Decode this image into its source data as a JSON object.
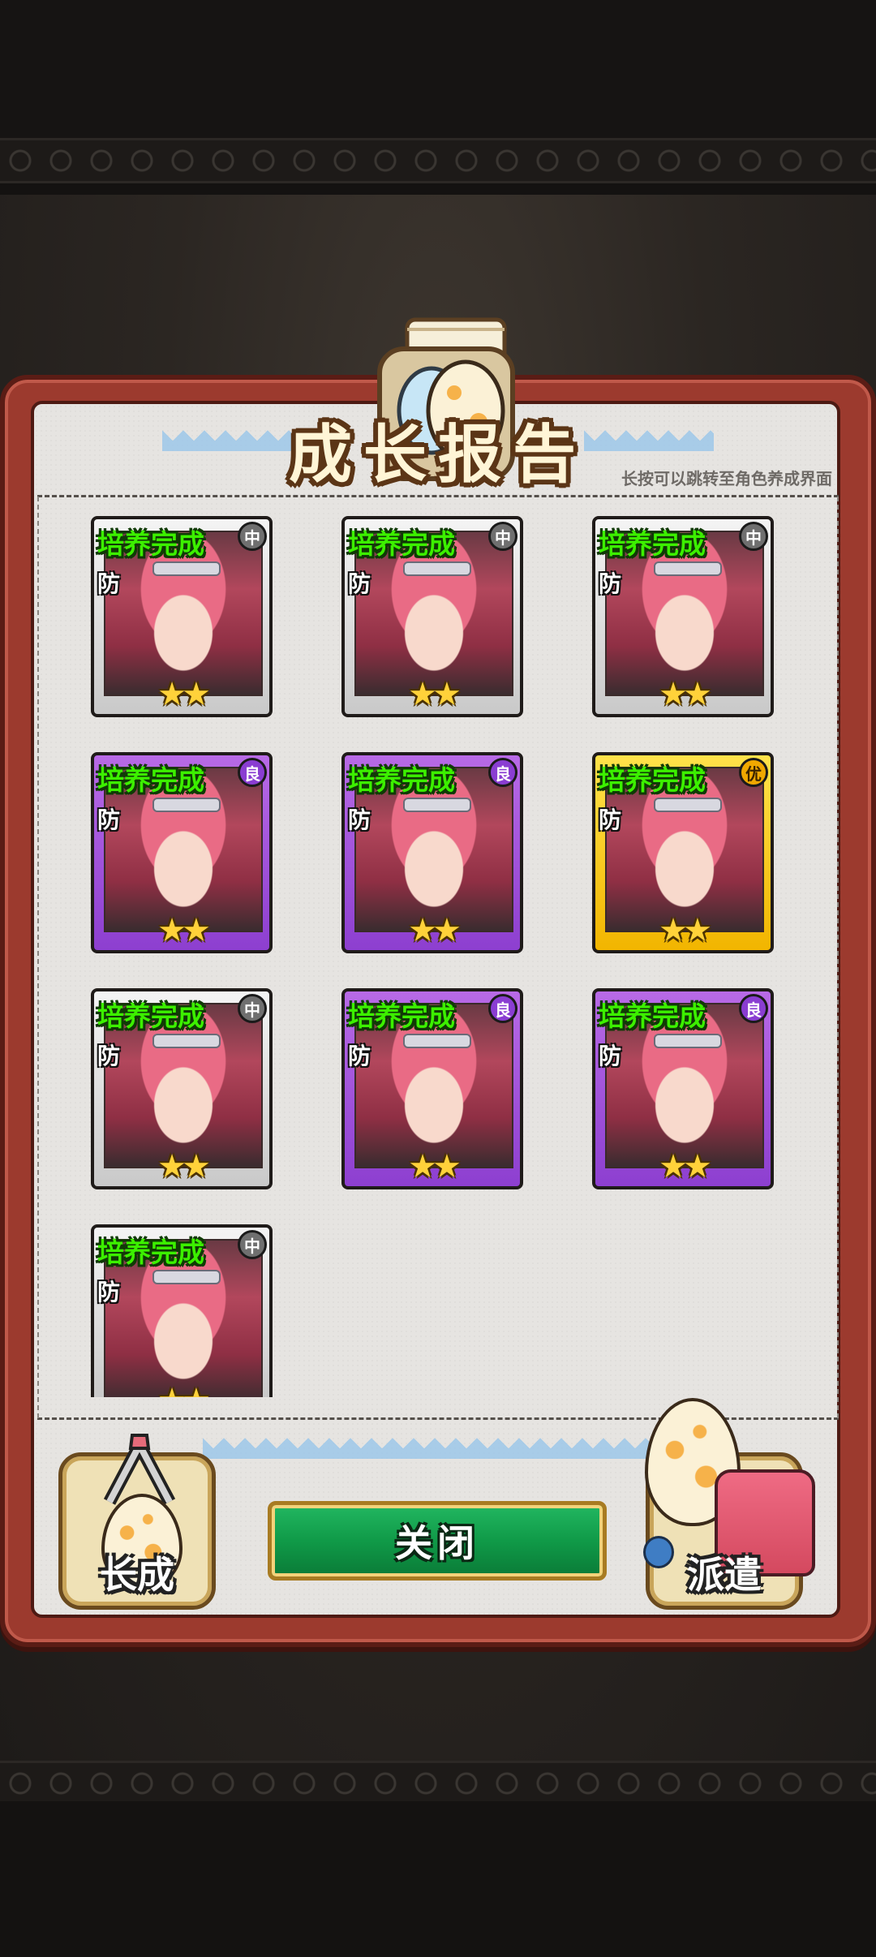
{
  "header": {
    "title": "成长报告",
    "hint": "长按可以跳转至角色养成界面"
  },
  "colors": {
    "rarity_mid": "#d9d9d9",
    "rarity_good": "#9b4fdc",
    "rarity_best": "#f7c400",
    "status_text": "#3cf000",
    "panel_frame": "#9c3a2e"
  },
  "results": [
    {
      "status": "培养完成",
      "role": "防",
      "grade": "中",
      "rarity": "mid",
      "stars": "★★"
    },
    {
      "status": "培养完成",
      "role": "防",
      "grade": "中",
      "rarity": "mid",
      "stars": "★★"
    },
    {
      "status": "培养完成",
      "role": "防",
      "grade": "中",
      "rarity": "mid",
      "stars": "★★"
    },
    {
      "status": "培养完成",
      "role": "防",
      "grade": "良",
      "rarity": "good",
      "stars": "★★"
    },
    {
      "status": "培养完成",
      "role": "防",
      "grade": "良",
      "rarity": "good",
      "stars": "★★"
    },
    {
      "status": "培养完成",
      "role": "防",
      "grade": "优",
      "rarity": "best",
      "stars": "★★"
    },
    {
      "status": "培养完成",
      "role": "防",
      "grade": "中",
      "rarity": "mid",
      "stars": "★★"
    },
    {
      "status": "培养完成",
      "role": "防",
      "grade": "良",
      "rarity": "good",
      "stars": "★★"
    },
    {
      "status": "培养完成",
      "role": "防",
      "grade": "良",
      "rarity": "good",
      "stars": "★★"
    },
    {
      "status": "培养完成",
      "role": "防",
      "grade": "中",
      "rarity": "mid",
      "stars": "★★"
    }
  ],
  "buttons": {
    "grow": "长成",
    "close": "关闭",
    "dispatch": "派遣"
  },
  "icons": {
    "title": "egg-scroll-icon",
    "grow": "hatching-egg-icon",
    "dispatch": "egg-backpack-icon"
  }
}
